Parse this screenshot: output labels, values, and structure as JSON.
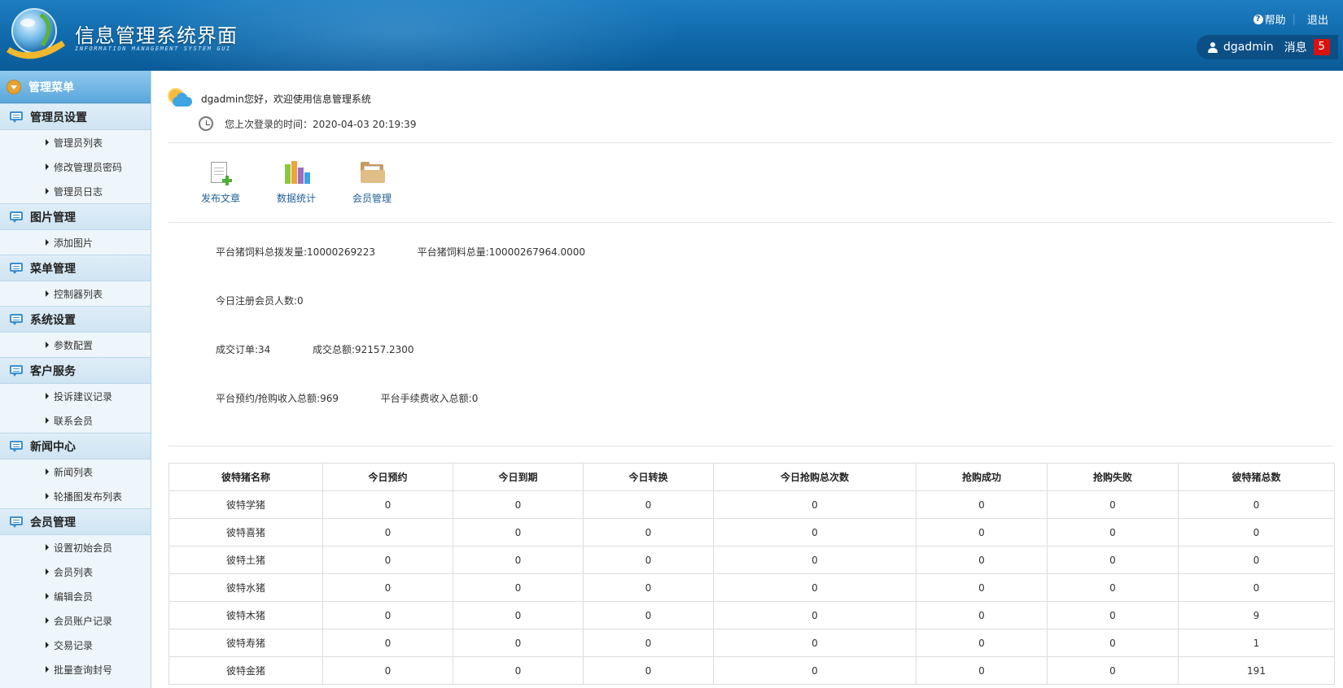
{
  "header": {
    "title": "信息管理系统界面",
    "subtitle": "INFORMATION MANAGEMENT SYSTEM GUI",
    "help_label": "帮助",
    "separator": "|",
    "logout_label": "退出",
    "username": "dgadmin",
    "messages_label": "消息",
    "messages_count": "5"
  },
  "sidebar": {
    "menu_title": "管理菜单",
    "groups": [
      {
        "title": "管理员设置",
        "items": [
          "管理员列表",
          "修改管理员密码",
          "管理员日志"
        ]
      },
      {
        "title": "图片管理",
        "items": [
          "添加图片"
        ]
      },
      {
        "title": "菜单管理",
        "items": [
          "控制器列表"
        ]
      },
      {
        "title": "系统设置",
        "items": [
          "参数配置"
        ]
      },
      {
        "title": "客户服务",
        "items": [
          "投诉建议记录",
          "联系会员"
        ]
      },
      {
        "title": "新闻中心",
        "items": [
          "新闻列表",
          "轮播图发布列表"
        ]
      },
      {
        "title": "会员管理",
        "items": [
          "设置初始会员",
          "会员列表",
          "编辑会员",
          "会员账户记录",
          "交易记录",
          "批量查询封号"
        ]
      }
    ]
  },
  "welcome": {
    "greeting": "dgadmin您好，欢迎使用信息管理系统",
    "last_login": "您上次登录的时间：2020-04-03 20:19:39"
  },
  "quick_actions": [
    {
      "label": "发布文章",
      "icon": "publish-article-icon"
    },
    {
      "label": "数据统计",
      "icon": "bar-chart-icon"
    },
    {
      "label": "会员管理",
      "icon": "folder-icon"
    }
  ],
  "stats": {
    "feed_issued": "平台猪饲料总拨发量:10000269223",
    "feed_total": "平台猪饲料总量:10000267964.0000",
    "new_members_today": "今日注册会员人数:0",
    "orders_count": "成交订单:34",
    "orders_amount": "成交总额:92157.2300",
    "reserve_income": "平台预约/抢购收入总额:969",
    "fee_income": "平台手续费收入总额:0"
  },
  "table": {
    "headers": [
      "彼特猪名称",
      "今日预约",
      "今日到期",
      "今日转换",
      "今日抢购总次数",
      "抢购成功",
      "抢购失败",
      "彼特猪总数"
    ],
    "rows": [
      [
        "彼特学猪",
        "0",
        "0",
        "0",
        "0",
        "0",
        "0",
        "0"
      ],
      [
        "彼特喜猪",
        "0",
        "0",
        "0",
        "0",
        "0",
        "0",
        "0"
      ],
      [
        "彼特土猪",
        "0",
        "0",
        "0",
        "0",
        "0",
        "0",
        "0"
      ],
      [
        "彼特水猪",
        "0",
        "0",
        "0",
        "0",
        "0",
        "0",
        "0"
      ],
      [
        "彼特木猪",
        "0",
        "0",
        "0",
        "0",
        "0",
        "0",
        "9"
      ],
      [
        "彼特寿猪",
        "0",
        "0",
        "0",
        "0",
        "0",
        "0",
        "1"
      ],
      [
        "彼特金猪",
        "0",
        "0",
        "0",
        "0",
        "0",
        "0",
        "191"
      ]
    ]
  },
  "colors": {
    "header_blue": "#0f69aa",
    "menu_head_blue": "#5aa7dc",
    "sidebar_bg": "#eef6fb",
    "badge_red": "#d8130f",
    "link_blue": "#1d5f99"
  }
}
